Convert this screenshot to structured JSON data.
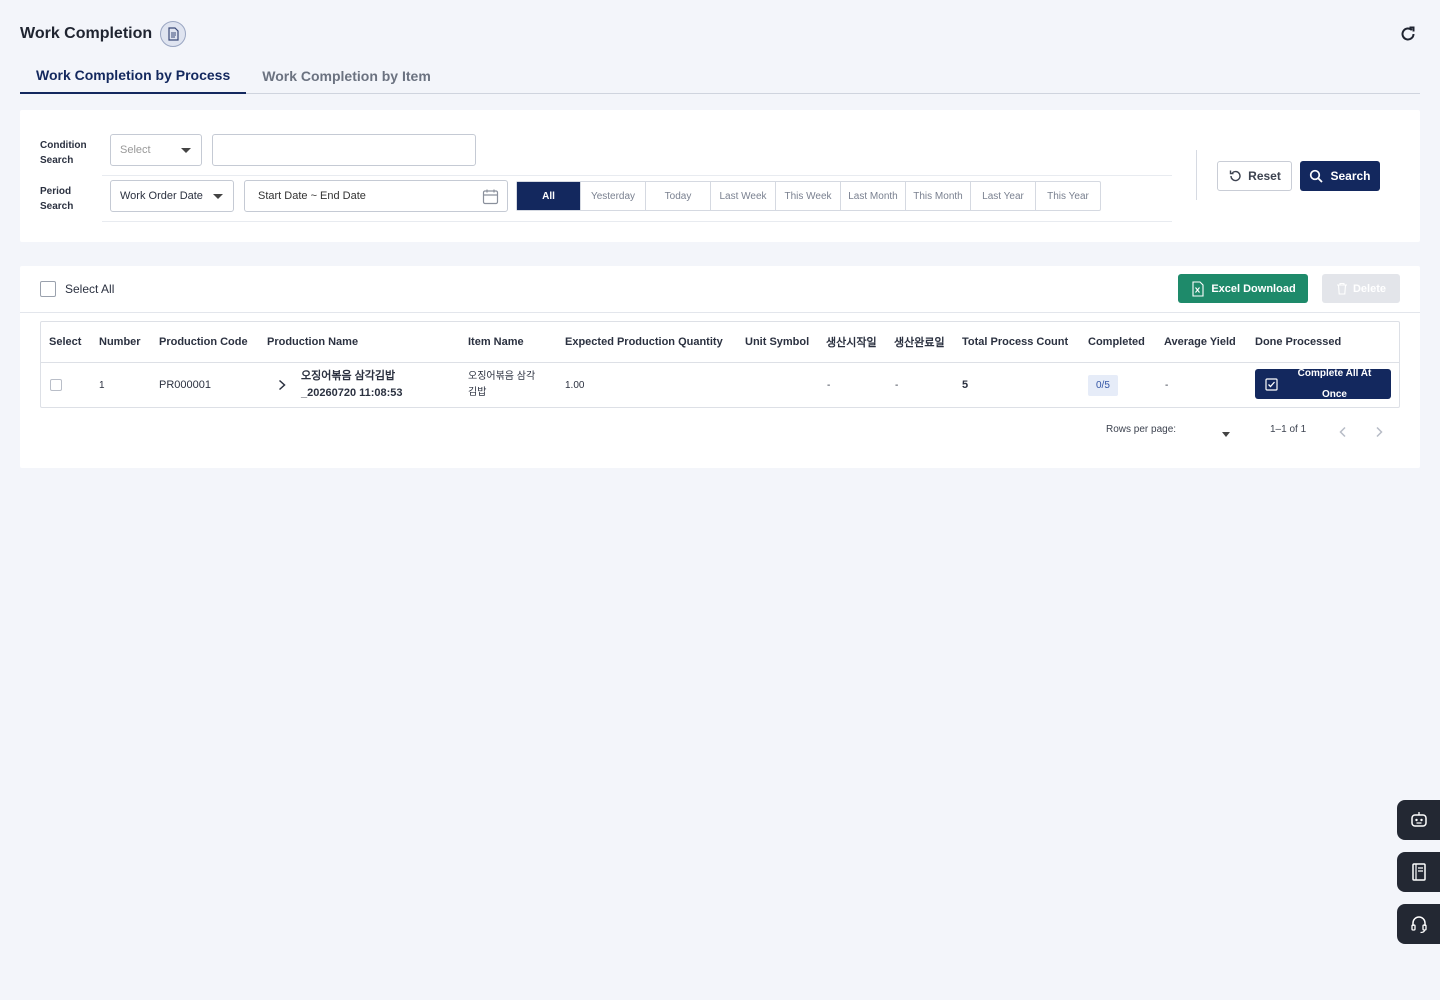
{
  "header": {
    "title": "Work Completion"
  },
  "tabs": [
    {
      "label": "Work Completion by Process",
      "active": true
    },
    {
      "label": "Work Completion by Item",
      "active": false
    }
  ],
  "filters": {
    "condition_label_1": "Condition",
    "condition_label_2": "Search",
    "condition_select": "Select",
    "condition_value": "",
    "period_label_1": "Period",
    "period_label_2": "Search",
    "period_select": "Work Order Date",
    "date_range": "Start Date ~ End Date",
    "periods": [
      "All",
      "Yesterday",
      "Today",
      "Last Week",
      "This Week",
      "Last Month",
      "This Month",
      "Last Year",
      "This Year"
    ],
    "active_period": "All",
    "reset_label": "Reset",
    "search_label": "Search"
  },
  "toolbar": {
    "select_all_label": "Select All",
    "excel_label": "Excel Download",
    "delete_label": "Delete"
  },
  "table": {
    "columns": [
      "Select",
      "Number",
      "Production Code",
      "Production Name",
      "Item Name",
      "Expected Production Quantity",
      "Unit Symbol",
      "생산시작일",
      "생산완료일",
      "Total Process Count",
      "Completed",
      "Average Yield",
      "Done Processed"
    ],
    "rows": [
      {
        "number": "1",
        "production_code": "PR000001",
        "production_name_1": "오징어볶음 삼각김밥",
        "production_name_2": "_20260720 11:08:53",
        "item_name_1": "오징어볶음 삼각",
        "item_name_2": "김밥",
        "expected_qty": "1.00",
        "unit_symbol": "",
        "start_date": "-",
        "end_date": "-",
        "total_process_count": "5",
        "completed": "0/5",
        "average_yield": "-",
        "action_label_1": "Complete All At",
        "action_label_2": "Once"
      }
    ]
  },
  "pagination": {
    "rows_per_page_label": "Rows per page:",
    "range": "1–1 of 1"
  },
  "colors": {
    "primary": "#13285e",
    "excel": "#1e8a6a",
    "background": "#f3f5fa"
  },
  "icons": [
    "document-icon",
    "refresh-icon",
    "calendar-icon",
    "reset-icon",
    "search-icon",
    "excel-icon",
    "trash-icon",
    "chevron-right-icon",
    "check-square-icon",
    "chevron-left-icon",
    "chatbot-icon",
    "manual-icon",
    "headset-icon"
  ]
}
